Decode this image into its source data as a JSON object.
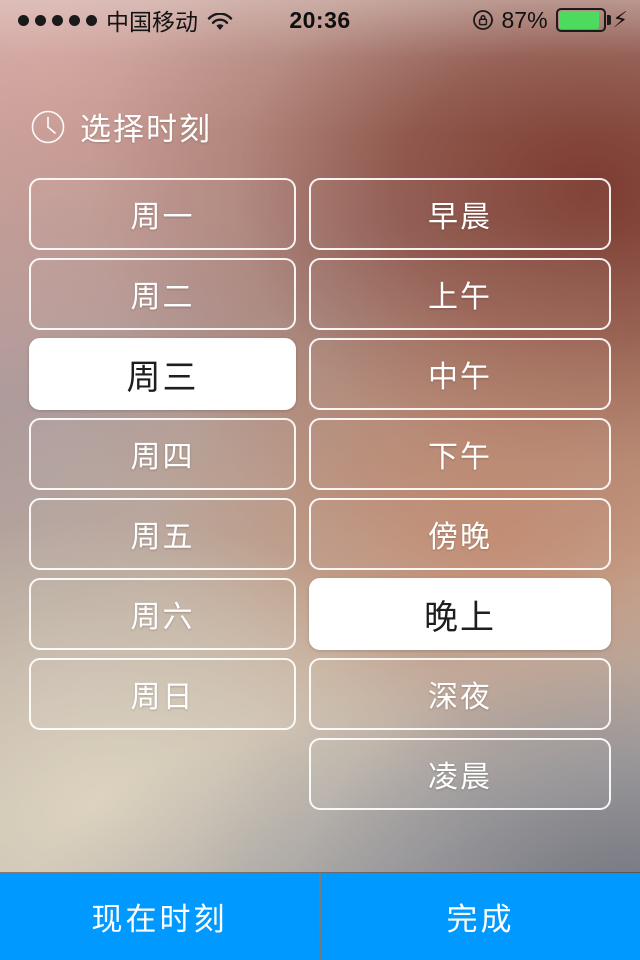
{
  "status_bar": {
    "signal_dots": 5,
    "carrier": "中国移动",
    "wifi_icon": "wifi-icon",
    "time": "20:36",
    "lock_icon": "rotation-lock-icon",
    "battery_percent": "87%",
    "battery_fill_color": "#4cdb5f",
    "charging_icon": "⚡"
  },
  "header": {
    "icon": "clock-icon",
    "title": "选择时刻"
  },
  "picker": {
    "days": [
      {
        "label": "周一",
        "selected": false
      },
      {
        "label": "周二",
        "selected": false
      },
      {
        "label": "周三",
        "selected": true
      },
      {
        "label": "周四",
        "selected": false
      },
      {
        "label": "周五",
        "selected": false
      },
      {
        "label": "周六",
        "selected": false
      },
      {
        "label": "周日",
        "selected": false
      }
    ],
    "times": [
      {
        "label": "早晨",
        "selected": false
      },
      {
        "label": "上午",
        "selected": false
      },
      {
        "label": "中午",
        "selected": false
      },
      {
        "label": "下午",
        "selected": false
      },
      {
        "label": "傍晚",
        "selected": false
      },
      {
        "label": "晚上",
        "selected": true
      },
      {
        "label": "深夜",
        "selected": false
      },
      {
        "label": "凌晨",
        "selected": false
      }
    ]
  },
  "actions": {
    "now_label": "现在时刻",
    "done_label": "完成",
    "accent_color": "#0099ff"
  },
  "theme": {
    "background_top_left": "#c6a49c",
    "background_top_right": "#7d3d32",
    "background_mid_right": "#c47c5c",
    "background_bottom_left": "#cfc7b9",
    "background_bottom_right": "#8b8c92",
    "option_border": "#ffffff",
    "selected_background": "#ffffff",
    "selected_text": "#1e1e1e"
  }
}
